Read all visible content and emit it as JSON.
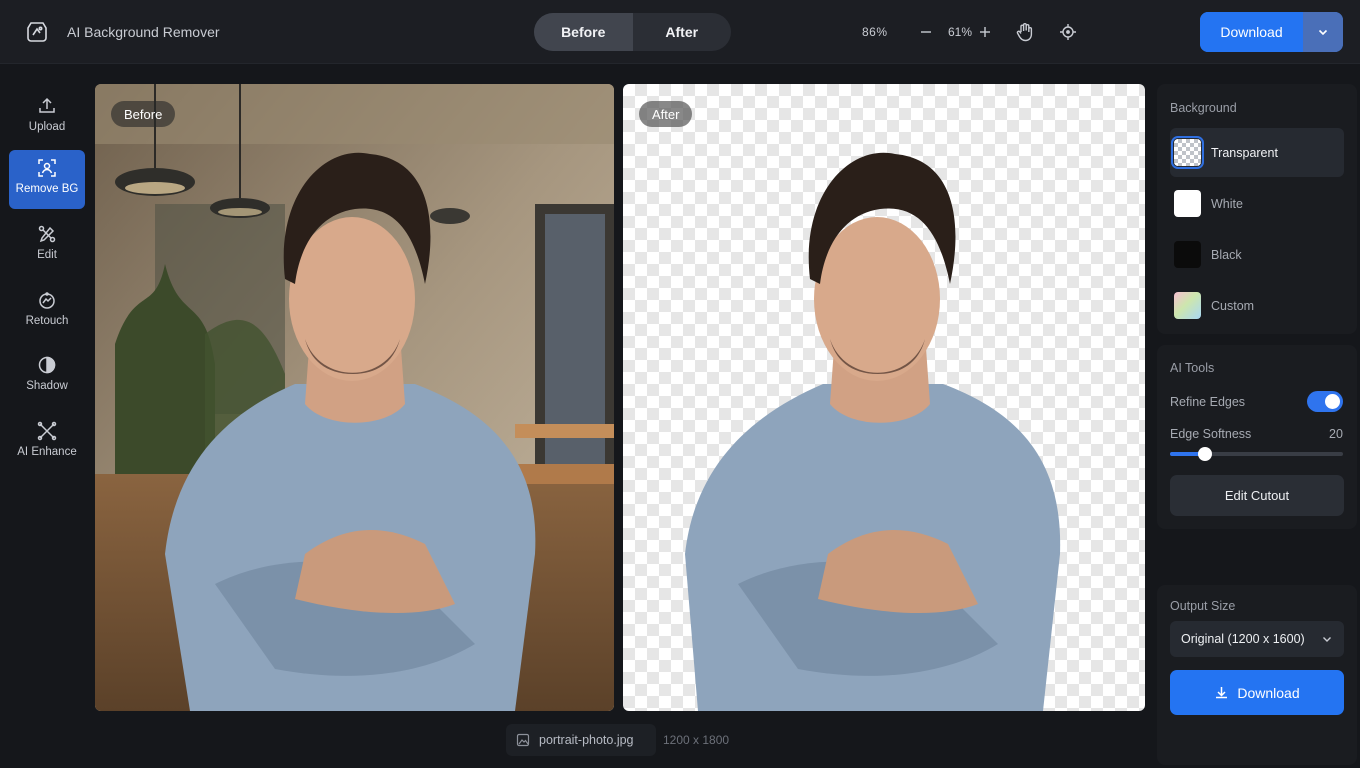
{
  "header": {
    "app_title": "AI Background Remover",
    "icons": {
      "logo": "app-logo-icon",
      "zoom_out": "minus-icon",
      "zoom_in": "plus-icon",
      "pan": "hand-icon",
      "crop": "crop-icon",
      "dropdown": "chevron-down-icon"
    },
    "view_toggle": {
      "before": "Before",
      "after": "After",
      "active": "Before"
    },
    "zoom_readout_a": "86%",
    "zoom_readout_b": "61%",
    "download_label": "Download"
  },
  "sidebar": {
    "items": [
      {
        "label": "Upload",
        "icon": "upload-icon",
        "active": false
      },
      {
        "label": "Remove BG",
        "icon": "remove-bg-icon",
        "active": true
      },
      {
        "label": "Edit",
        "icon": "edit-icon",
        "active": false
      },
      {
        "label": "Retouch",
        "icon": "retouch-icon",
        "active": false
      },
      {
        "label": "Shadow",
        "icon": "shadow-icon",
        "active": false
      },
      {
        "label": "AI Enhance",
        "icon": "ai-enhance-icon",
        "active": false
      }
    ]
  },
  "canvas": {
    "before_tag": "Before",
    "after_tag": "After",
    "file_name": "portrait-photo.jpg",
    "file_dimensions": "1200 x 1800"
  },
  "background_panel": {
    "title": "Background",
    "options": [
      {
        "label": "Transparent",
        "active": true
      },
      {
        "label": "White",
        "active": false
      },
      {
        "label": "Black",
        "active": false
      },
      {
        "label": "Custom",
        "active": false
      }
    ]
  },
  "ai_tools": {
    "title": "AI Tools",
    "refine_edges_label": "Refine Edges",
    "refine_edges_on": true,
    "edge_softness_label": "Edge Softness",
    "edge_softness_value": "20",
    "edge_softness_fraction": 0.2,
    "edit_cutout_label": "Edit Cutout"
  },
  "output": {
    "title": "Output Size",
    "selected_size": "Original (1200 x 1600)",
    "download_label": "Download"
  },
  "colors": {
    "accent": "#2474f2",
    "active_sidebar": "#2a62c9",
    "app_bg": "#15171b"
  }
}
